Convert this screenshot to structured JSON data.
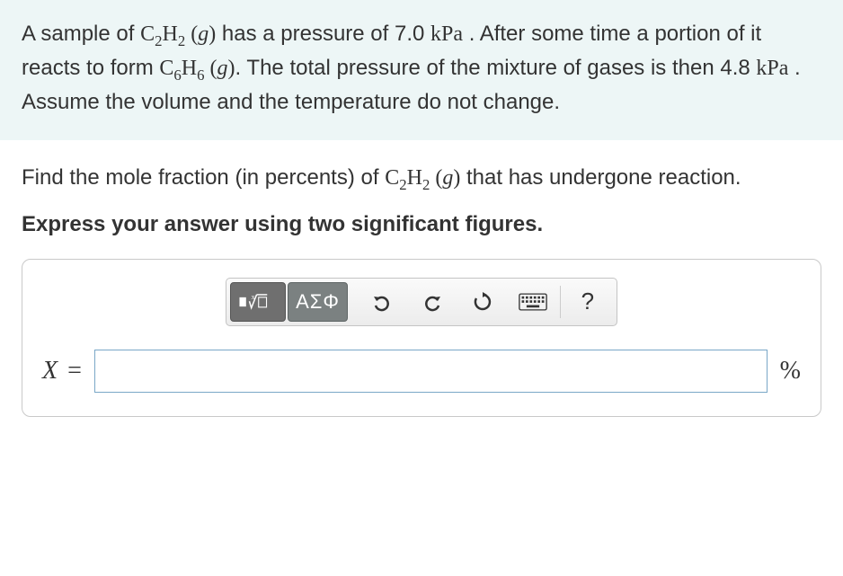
{
  "intro": {
    "t1": "A sample of ",
    "f1": "C",
    "f1s1": "2",
    "f1b": "H",
    "f1s2": "2",
    "state1a": " (",
    "state1g": "g",
    "state1b": ")",
    "t2": " has a pressure of 7.0 ",
    "unit1": "kPa",
    "t3": " . After some time a portion of it reacts to form ",
    "f2": "C",
    "f2s1": "6",
    "f2b": "H",
    "f2s2": "6",
    "state2a": " (",
    "state2g": "g",
    "state2b": ")",
    "t4": ". The total pressure of the mixture of gases is then 4.8 ",
    "unit2": "kPa",
    "t5": " . Assume the volume and the temperature do not change."
  },
  "question": {
    "t1": "Find the mole fraction (in percents) of ",
    "f1": "C",
    "f1s1": "2",
    "f1b": "H",
    "f1s2": "2",
    "state1a": " (",
    "state1g": "g",
    "state1b": ")",
    "t2": " that has undergone reaction."
  },
  "instruction": "Express your answer using two significant figures.",
  "toolbar": {
    "greek": "ΑΣΦ",
    "help": "?"
  },
  "answer": {
    "var": "X",
    "eq": " =",
    "value": "",
    "unit": "%"
  }
}
